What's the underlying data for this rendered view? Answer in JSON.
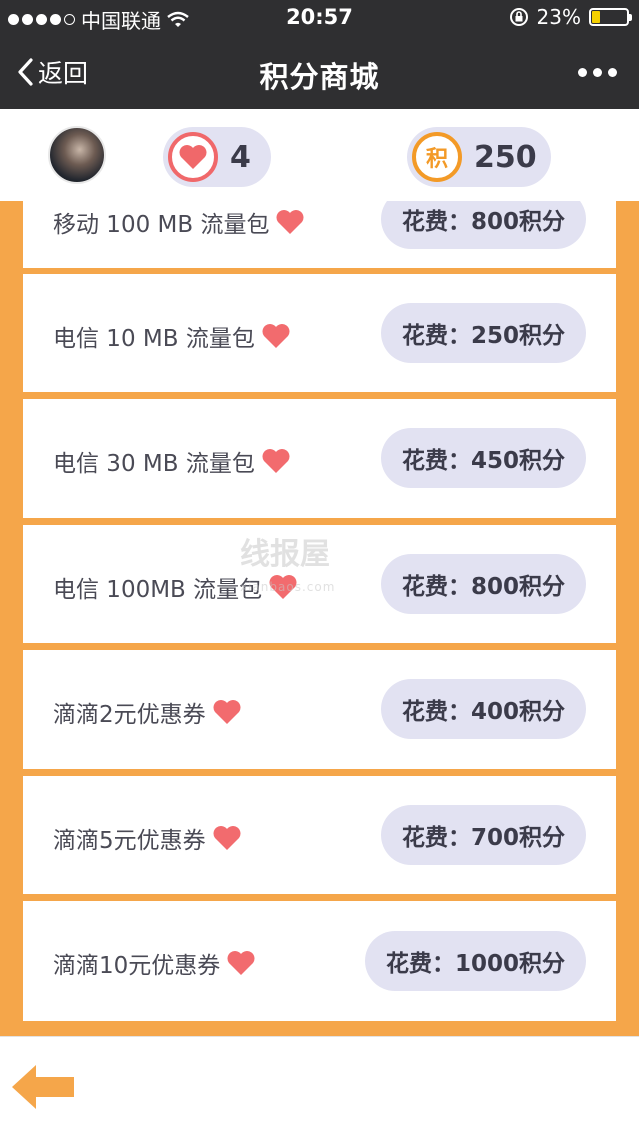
{
  "status_bar": {
    "carrier": "中国联通",
    "time": "20:57",
    "battery": "23%",
    "battery_level": 0.23,
    "signal_bars_filled": 4,
    "signal_bars_total": 5,
    "icons": [
      "wifi-icon",
      "rotation-lock-icon",
      "battery-icon"
    ]
  },
  "nav": {
    "back_label": "返回",
    "title": "积分商城",
    "more_icon": "ellipsis-icon"
  },
  "user": {
    "hearts": "4",
    "points_badge": "积",
    "points": "250"
  },
  "items": [
    {
      "name": "移动 100 MB 流量包",
      "price": "花费：800积分"
    },
    {
      "name": "电信 10 MB 流量包",
      "price": "花费：250积分"
    },
    {
      "name": "电信 30 MB 流量包",
      "price": "花费：450积分"
    },
    {
      "name": "电信 100MB 流量包",
      "price": "花费：800积分"
    },
    {
      "name": "滴滴2元优惠券",
      "price": "花费：400积分"
    },
    {
      "name": "滴滴5元优惠券",
      "price": "花费：700积分"
    },
    {
      "name": "滴滴10元优惠券",
      "price": "花费：1000积分"
    }
  ],
  "watermark": {
    "text": "线报屋",
    "sub": "xianbaos.com"
  },
  "colors": {
    "header_bg": "#2f2f31",
    "accent_orange": "#f5a64a",
    "heart_red": "#f0686a",
    "pill_bg": "#e2e2f2"
  }
}
